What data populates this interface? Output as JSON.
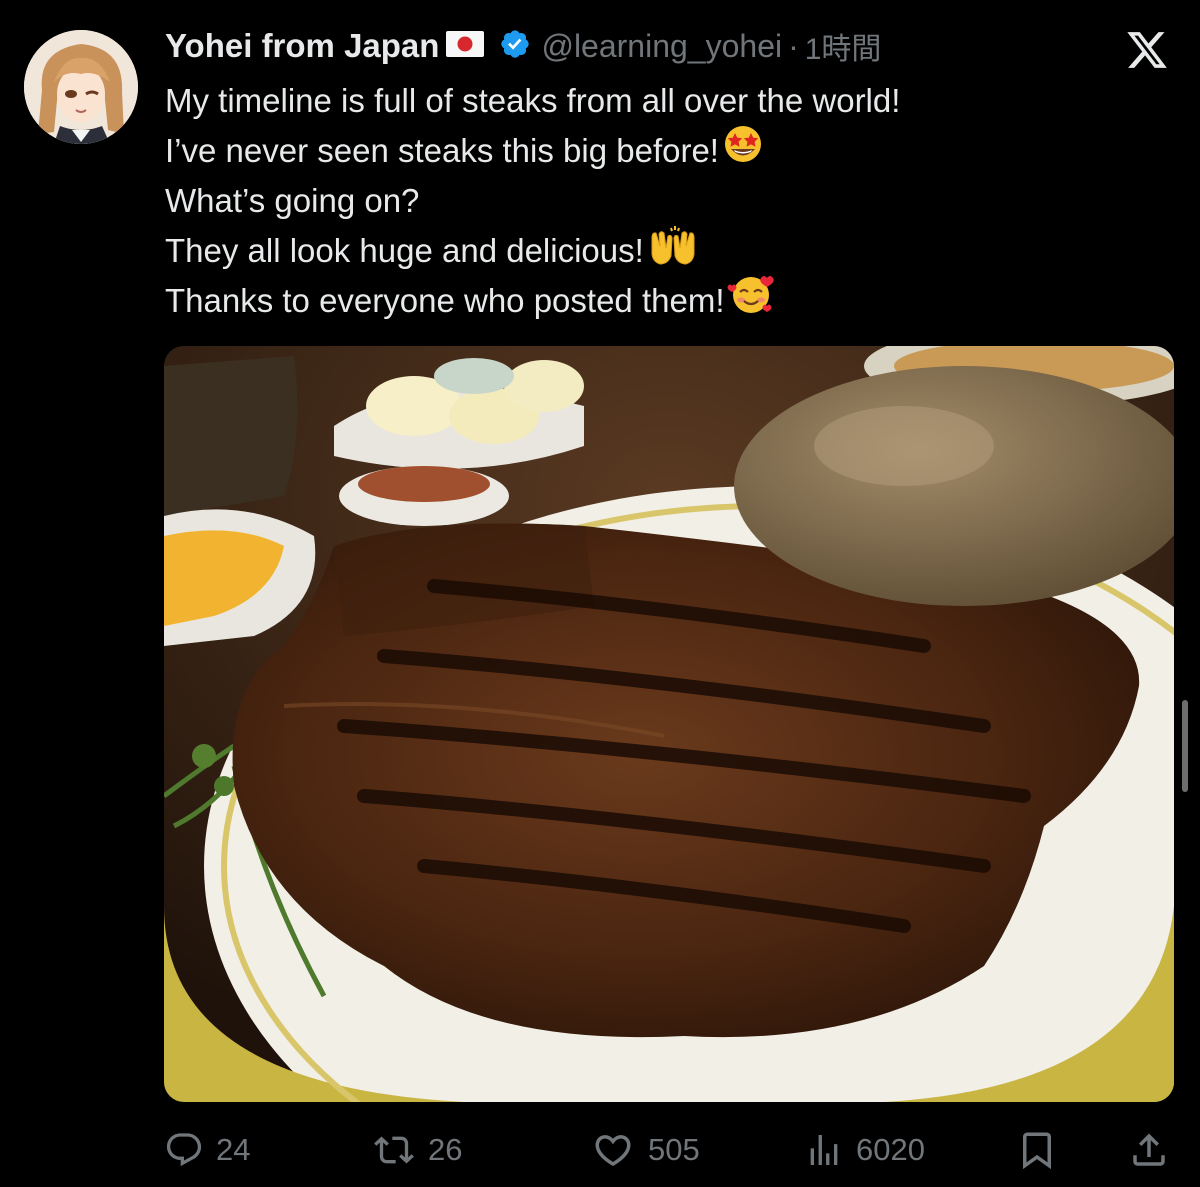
{
  "tweet": {
    "display_name": "Yohei from Japan",
    "handle": "@learning_yohei",
    "separator": "·",
    "timestamp": "1時間",
    "lines": [
      {
        "text": "My timeline is full of steaks from all over the world!",
        "emoji": ""
      },
      {
        "text": "I’ve never seen steaks this big before!",
        "emoji": "star-struck-emoji"
      },
      {
        "text": "What’s going on?",
        "emoji": ""
      },
      {
        "text": "They all look huge and delicious!",
        "emoji": "raising-hands-emoji"
      },
      {
        "text": "Thanks to everyone who posted them!",
        "emoji": "smiling-face-with-hearts-emoji"
      }
    ]
  },
  "media": {
    "description_icon": "photo"
  },
  "actions": {
    "reply_count": "24",
    "retweet_count": "26",
    "like_count": "505",
    "views_count": "6020"
  },
  "icons": {
    "reply": "reply-icon",
    "retweet": "retweet-icon",
    "like": "heart-icon",
    "views": "views-icon",
    "bookmark": "bookmark-icon",
    "share": "share-icon",
    "brand": "x-logo-icon",
    "verified": "verified-badge-icon"
  },
  "colors": {
    "background": "#000000",
    "text": "#e7e9ea",
    "muted": "#71767b",
    "verified": "#1d9bf0"
  }
}
